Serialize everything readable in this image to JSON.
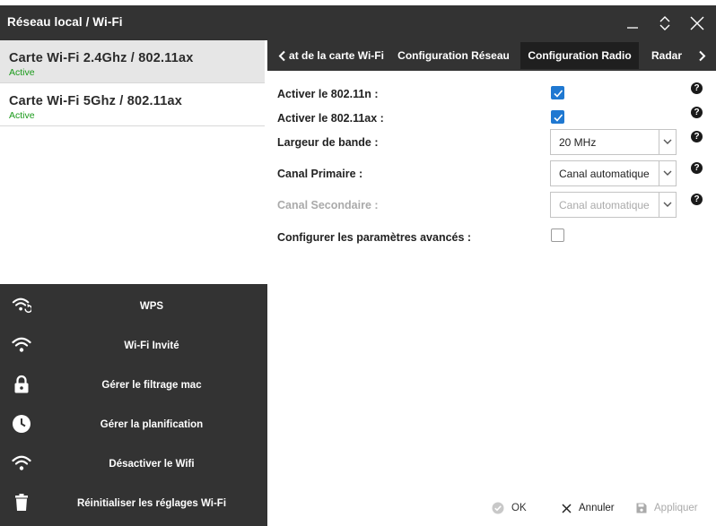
{
  "window": {
    "title": "Réseau local / Wi-Fi"
  },
  "cards": [
    {
      "name": "Carte Wi-Fi 2.4Ghz / 802.11ax",
      "status": "Active"
    },
    {
      "name": "Carte Wi-Fi 5Ghz / 802.11ax",
      "status": "Active"
    }
  ],
  "sidebar": {
    "items": [
      {
        "label": "WPS",
        "icon": "wifi-refresh-icon"
      },
      {
        "label": "Wi-Fi Invité",
        "icon": "wifi-icon"
      },
      {
        "label": "Gérer le filtrage mac",
        "icon": "lock-icon"
      },
      {
        "label": "Gérer la planification",
        "icon": "clock-icon"
      },
      {
        "label": "Désactiver le Wifi",
        "icon": "wifi-icon"
      },
      {
        "label": "Réinitialiser les réglages Wi-Fi",
        "icon": "trash-icon"
      }
    ]
  },
  "tabs": {
    "items": [
      {
        "label": "at de la carte Wi-Fi"
      },
      {
        "label": "Configuration Réseau"
      },
      {
        "label": "Configuration Radio"
      },
      {
        "label": "Radar"
      }
    ],
    "active_index": 2
  },
  "form": {
    "enable_11n": {
      "label": "Activer le 802.11n :",
      "checked": true
    },
    "enable_11ax": {
      "label": "Activer le 802.11ax :",
      "checked": true
    },
    "bandwidth": {
      "label": "Largeur de bande :",
      "value": "20 MHz"
    },
    "primary_channel": {
      "label": "Canal Primaire :",
      "value": "Canal automatique"
    },
    "secondary_channel": {
      "label": "Canal Secondaire :",
      "value": "Canal automatique",
      "disabled": true
    },
    "advanced": {
      "label": "Configurer les paramètres avancés :",
      "checked": false
    },
    "help_glyph": "?"
  },
  "footer": {
    "ok_label": "OK",
    "cancel_label": "Annuler",
    "apply_label": "Appliquer"
  },
  "colors": {
    "dark_bg": "#333333",
    "active_tab": "#1f1f1f",
    "status_green": "#1a9a1a",
    "checkbox_blue": "#1f78d1",
    "disabled_text": "#aaaaaa"
  }
}
